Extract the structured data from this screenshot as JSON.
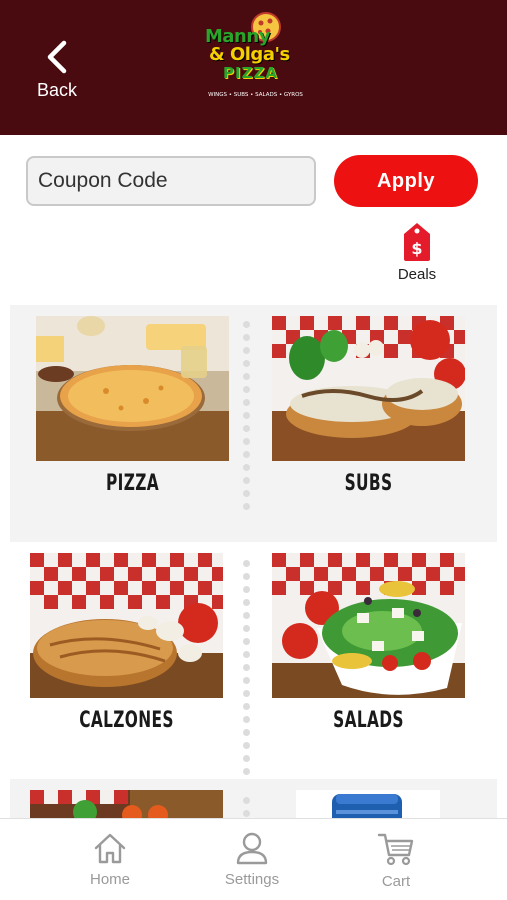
{
  "header": {
    "back_label": "Back",
    "logo": {
      "line1": "Manny",
      "line2": "& Olga's",
      "line3": "PIZZA",
      "tagline": "WINGS • SUBS • SALADS • GYROS"
    },
    "background_color": "#4a0b10"
  },
  "coupon": {
    "placeholder": "Coupon Code",
    "value": "",
    "apply_label": "Apply",
    "apply_color": "#ee1111"
  },
  "deals": {
    "label": "Deals",
    "icon": "price-tag-dollar-icon",
    "color": "#e41b2b"
  },
  "categories": [
    {
      "label": "PIZZA"
    },
    {
      "label": "SUBS"
    },
    {
      "label": "CALZONES"
    },
    {
      "label": "SALADS"
    },
    {
      "label": ""
    },
    {
      "label": ""
    }
  ],
  "tabbar": {
    "items": [
      {
        "label": "Home",
        "icon": "home-icon"
      },
      {
        "label": "Settings",
        "icon": "person-icon"
      },
      {
        "label": "Cart",
        "icon": "cart-icon"
      }
    ]
  }
}
